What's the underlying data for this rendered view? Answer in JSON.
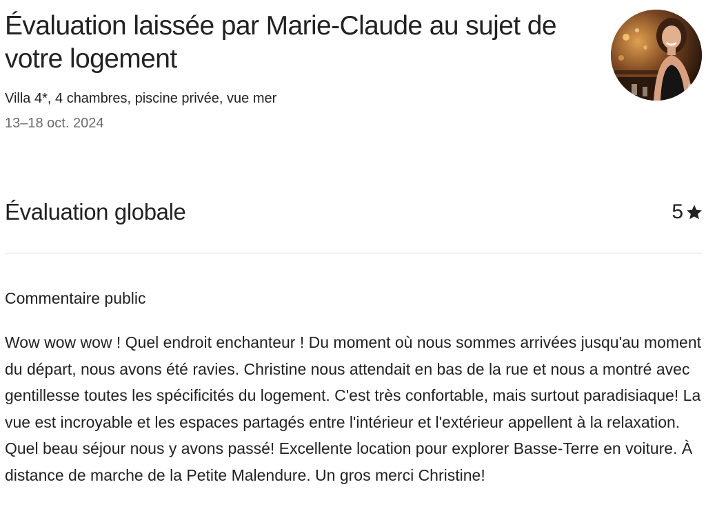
{
  "review": {
    "title": "Évaluation laissée par Marie-Claude au sujet de votre logement",
    "listing_name": "Villa 4*, 4 chambres, piscine privée, vue mer",
    "dates": "13–18 oct. 2024",
    "reviewer_avatar": "reviewer-avatar-photo"
  },
  "overall": {
    "label": "Évaluation globale",
    "score": "5",
    "icon": "star-icon"
  },
  "comment": {
    "heading": "Commentaire public",
    "text": "Wow wow wow ! Quel endroit enchanteur ! Du moment où nous sommes arrivées jusqu'au moment du départ, nous avons été ravies. Christine nous attendait en bas de la rue et nous a montré avec gentillesse toutes les spécificités du logement. C'est très confortable, mais surtout paradisiaque! La vue est incroyable et les espaces partagés entre l'intérieur et l'extérieur appellent à la relaxation. Quel beau séjour nous y avons passé! Excellente location pour explorer Basse-Terre en voiture. À distance de marche de la Petite Malendure. Un gros merci Christine!"
  },
  "colors": {
    "text": "#222222",
    "muted": "#6a6a6a",
    "divider": "#dddddd"
  }
}
